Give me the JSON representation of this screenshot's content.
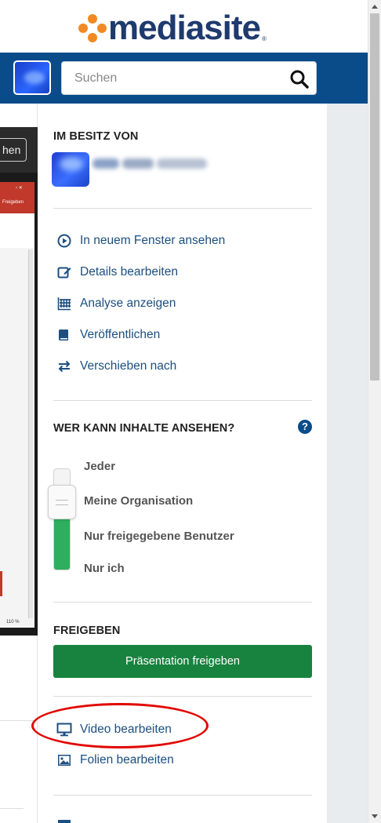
{
  "header": {
    "logo_text": "mediasite",
    "logo_color": "#1e3a6e",
    "logo_mark_color": "#f18a24"
  },
  "search": {
    "placeholder": "Suchen",
    "icon": "search-icon"
  },
  "player": {
    "button_label_partial": "hen",
    "ribbon_label": "Freigeben",
    "zoom_label": "110 %"
  },
  "owner": {
    "title": "IM BESITZ VON"
  },
  "actions": [
    {
      "label": "In neuem Fenster ansehen",
      "icon": "play-circle-icon"
    },
    {
      "label": "Details bearbeiten",
      "icon": "edit-icon"
    },
    {
      "label": "Analyse anzeigen",
      "icon": "analytics-grid-icon"
    },
    {
      "label": "Veröffentlichen",
      "icon": "book-icon"
    },
    {
      "label": "Verschieben nach",
      "icon": "move-arrows-icon"
    }
  ],
  "visibility": {
    "title": "WER KANN INHALTE ANSEHEN?",
    "help_label": "?",
    "options": [
      "Jeder",
      "Meine Organisation",
      "Nur freigegebene Benutzer",
      "Nur ich"
    ],
    "selected": "Meine Organisation",
    "fill_fraction": 0.55,
    "fill_color": "#2fae60"
  },
  "share": {
    "title": "FREIGEBEN",
    "button_label": "Präsentation freigeben",
    "button_color": "#17833f"
  },
  "edit_actions": [
    {
      "label": "Video bearbeiten",
      "icon": "monitor-icon"
    },
    {
      "label": "Folien bearbeiten",
      "icon": "image-icon"
    }
  ],
  "colors": {
    "header_blue": "#0a4b8a",
    "link_blue": "#1c4f80",
    "highlight_red": "#e10600"
  }
}
